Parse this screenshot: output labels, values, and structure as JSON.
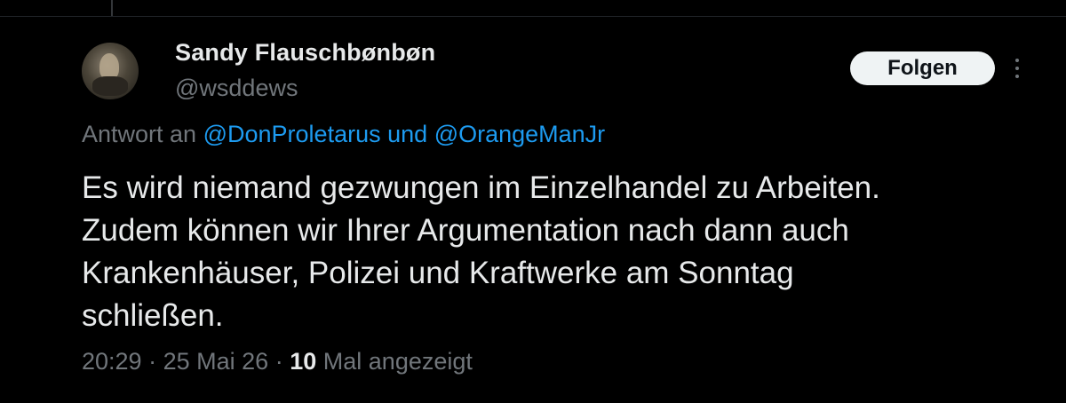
{
  "author": {
    "display_name": "Sandy Flauschbønbøn",
    "handle": "@wsddews"
  },
  "actions": {
    "follow_label": "Folgen",
    "more_icon": "more-dots-vertical-icon"
  },
  "reply_context": {
    "prefix": "Antwort an",
    "mention1": "@DonProletarus",
    "connector": "und",
    "mention2": "@OrangeManJr"
  },
  "tweet": {
    "line1": "Es wird niemand gezwungen im Einzelhandel zu Arbeiten.",
    "line2": "Zudem können wir Ihrer Argumentation nach dann auch",
    "line3": "Krankenhäuser, Polizei und Kraftwerke am Sonntag",
    "line4": "schließen."
  },
  "meta": {
    "time": "20:29",
    "separator": "·",
    "date": "25 Mai 26",
    "views_count": "10",
    "views_label": "Mal angezeigt"
  },
  "colors": {
    "background": "#000000",
    "text_primary": "#e7e9ea",
    "text_secondary": "#71767b",
    "link": "#1d9bf0",
    "button_bg": "#eff3f4"
  }
}
